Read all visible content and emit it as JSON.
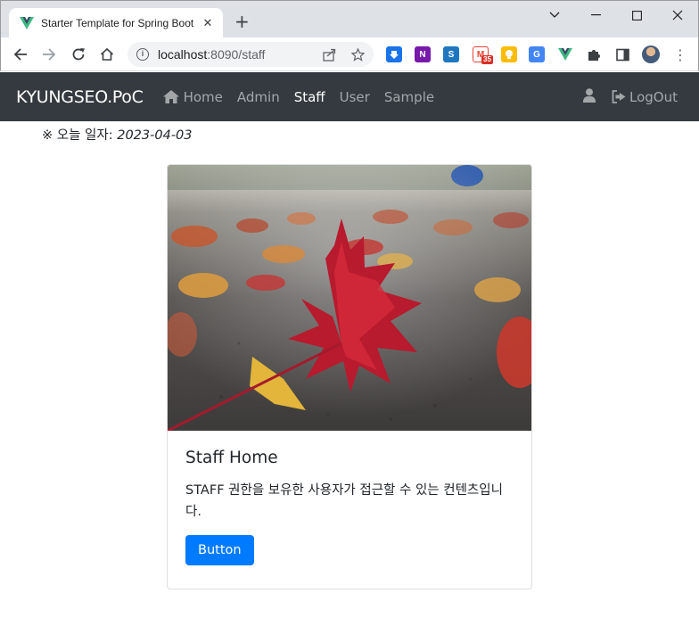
{
  "browser": {
    "tab_title": "Starter Template for Spring Boot",
    "tab_close": "✕",
    "new_tab": "+",
    "url_host": "localhost",
    "url_rest": ":8090/staff",
    "extensions": [
      {
        "name": "download-extension",
        "color": "#1a73e8"
      },
      {
        "name": "onenote-extension",
        "color": "#7719aa"
      },
      {
        "name": "snagit-extension",
        "color": "#1f77c0"
      },
      {
        "name": "gmail-extension",
        "color": "#ea4335",
        "badge": "35"
      },
      {
        "name": "keep-extension",
        "color": "#fbbc04"
      },
      {
        "name": "translate-extension",
        "color": "#4285f4"
      },
      {
        "name": "vue-devtools-extension",
        "color": "#41b883"
      }
    ]
  },
  "navbar": {
    "brand": "KYUNGSEO.PoC",
    "links": [
      "Home",
      "Admin",
      "Staff",
      "User",
      "Sample"
    ],
    "active": "Staff",
    "logout": "LogOut"
  },
  "today": {
    "label": "※ 오늘 일자:",
    "date": "2023-04-03"
  },
  "card": {
    "title": "Staff Home",
    "text": "STAFF 권한을 보유한 사용자가 접근할 수 있는 컨텐츠입니다.",
    "button": "Button",
    "image_alt": "red maple leaf on pavement"
  },
  "colors": {
    "navbar": "#343a40",
    "primary": "#007bff",
    "vue_green": "#41b883"
  }
}
